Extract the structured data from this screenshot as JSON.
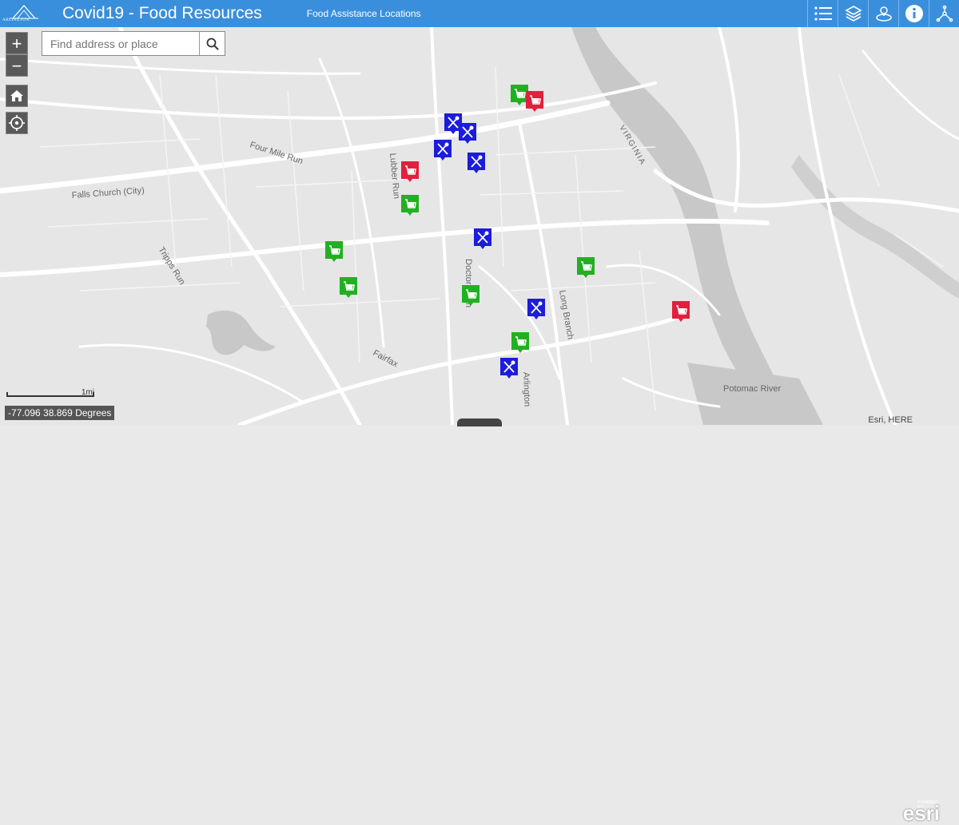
{
  "header": {
    "logo_text": "ARLINGTON",
    "logo_subtext": "VIRGINIA",
    "title": "Covid19 - Food Resources",
    "subtitle": "Food Assistance Locations",
    "tools": [
      {
        "name": "legend-icon"
      },
      {
        "name": "layers-icon"
      },
      {
        "name": "basemap-icon"
      },
      {
        "name": "info-icon"
      },
      {
        "name": "share-icon"
      }
    ],
    "color": "#3a8fdc"
  },
  "map_controls": {
    "zoom_in": "+",
    "zoom_out": "−",
    "search_placeholder": "Find address or place",
    "home": "home-icon",
    "locate": "locate-icon"
  },
  "map_labels": {
    "falls_church": "Falls Church (City)",
    "four_mile_run": "Four Mile Run",
    "tripps_run": "Tripps Run",
    "lubber_run": "Lubber Run",
    "doctors_run": "Doctors Run",
    "long_branch": "Long Branch",
    "virginia": "VIRGINIA",
    "fairfax": "Fairfax",
    "arlington": "Arlington",
    "potomac_river": "Potomac River"
  },
  "markers": [
    {
      "type": "grocery",
      "color": "#22b022"
    },
    {
      "type": "meal",
      "color": "#1c1cdc"
    },
    {
      "type": "meal-red",
      "color": "#e0203c"
    }
  ],
  "scale": {
    "label": "1mi"
  },
  "coordinates": "-77.096 38.869 Degrees",
  "attribution": "Esri, HERE",
  "esri": {
    "powered": "POWERED BY",
    "logo": "esri"
  }
}
